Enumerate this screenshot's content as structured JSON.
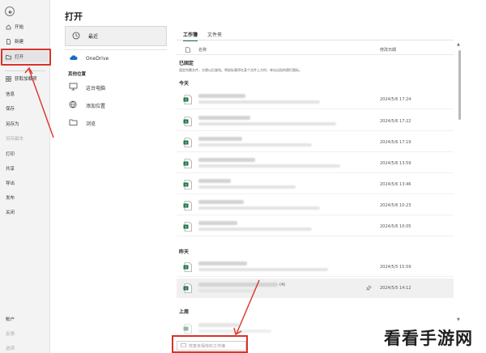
{
  "nav": {
    "top_items": [
      {
        "label": "开始",
        "icon": "home-icon"
      },
      {
        "label": "新建",
        "icon": "new-file-icon"
      },
      {
        "label": "打开",
        "icon": "folder-open-icon",
        "selected": true
      }
    ],
    "mid_items": [
      "获取加载项",
      "信息",
      "保存",
      "另存为",
      "另存副本",
      "打印",
      "共享",
      "导出",
      "发布",
      "关闭"
    ],
    "bottom_items": [
      "帐户",
      "反馈",
      "选项"
    ]
  },
  "page_title": "打开",
  "locations": {
    "recent_label": "最近",
    "onedrive_label": "OneDrive",
    "other_section": "其他位置",
    "this_pc_label": "这台电脑",
    "add_place_label": "添加位置",
    "browse_label": "浏览"
  },
  "tabs": [
    "工作簿",
    "文件夹"
  ],
  "columns": {
    "name": "名称",
    "modified": "修改日期"
  },
  "groups": {
    "pinned": "已固定",
    "pinned_desc": "固定所需文件，方便以后查找。将鼠标悬停在某个文件上方时，单击出现的图钉图标。",
    "today": "今天",
    "yesterday": "昨天",
    "last_week": "上周"
  },
  "files": [
    {
      "date": "2024/5/6 17:24",
      "text": ""
    },
    {
      "date": "2024/5/6 17:22",
      "text": ""
    },
    {
      "date": "2024/5/6 17:19",
      "text": ""
    },
    {
      "date": "2024/5/6 13:59",
      "text": ""
    },
    {
      "date": "2024/5/6 13:46",
      "text": ""
    },
    {
      "date": "2024/5/6 10:23",
      "text": ""
    },
    {
      "date": "2024/5/6 10:05",
      "text": ""
    },
    {
      "date": "2024/5/5 15:59",
      "text": ""
    },
    {
      "date": "2024/5/5 14:12",
      "text": "(4)"
    }
  ],
  "recover_button": "恢复未保存的工作簿",
  "watermark": "看看手游网",
  "colors": {
    "annotation": "#d8332a",
    "excel_green": "#217346",
    "nav_bg": "#f3f3f3"
  }
}
